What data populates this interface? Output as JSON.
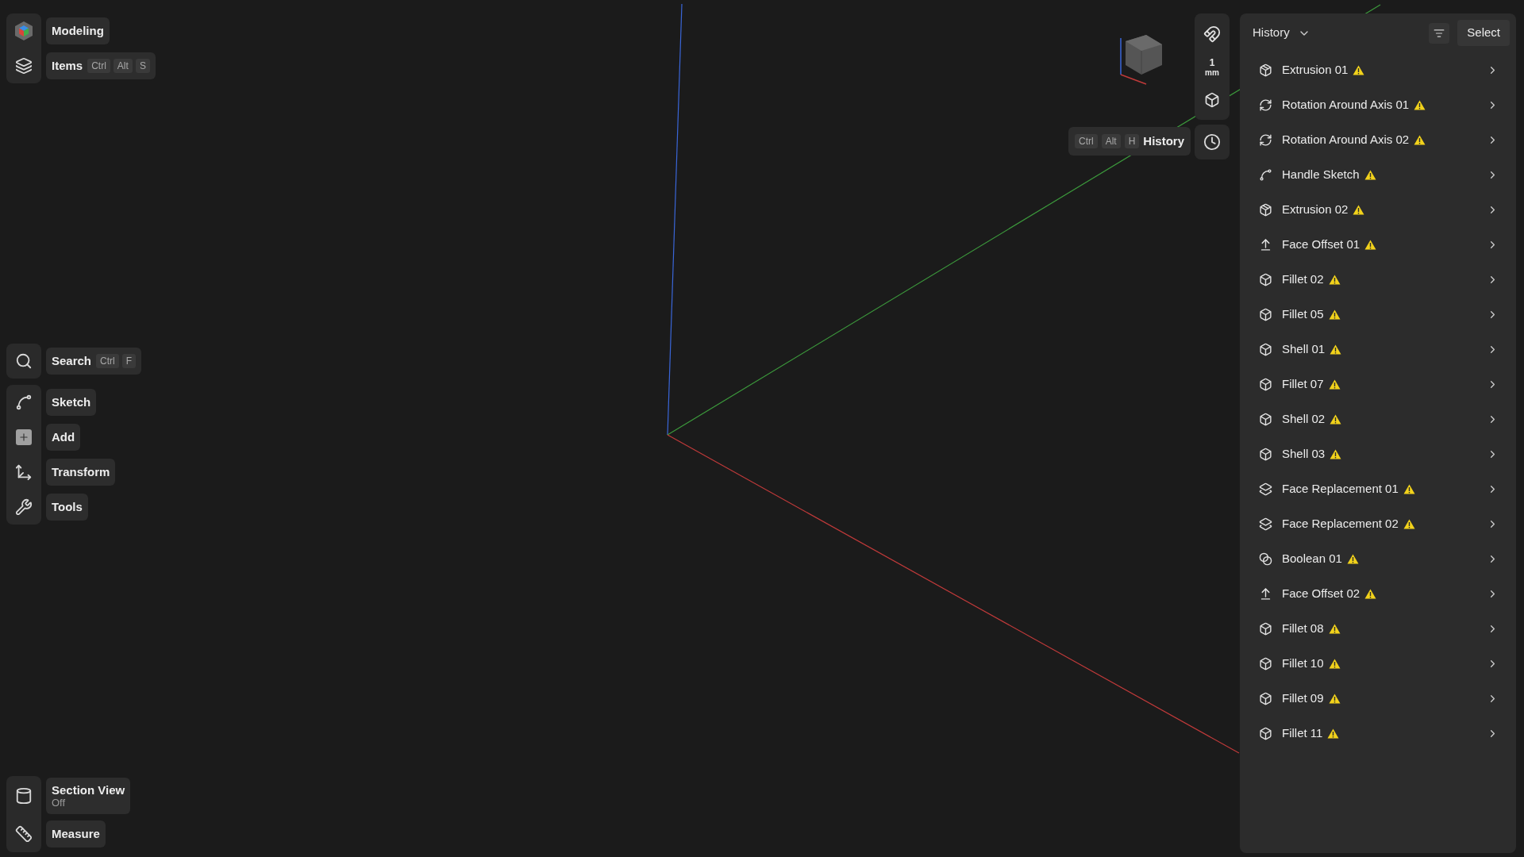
{
  "workspace_button": {
    "label": "Modeling"
  },
  "items_button": {
    "label": "Items",
    "shortcut": [
      "Ctrl",
      "Alt",
      "S"
    ]
  },
  "search_button": {
    "label": "Search",
    "shortcut": [
      "Ctrl",
      "F"
    ]
  },
  "tools": [
    {
      "kind": "sketch",
      "label": "Sketch"
    },
    {
      "kind": "add",
      "label": "Add"
    },
    {
      "kind": "transform",
      "label": "Transform"
    },
    {
      "kind": "tools",
      "label": "Tools"
    }
  ],
  "section_view": {
    "label": "Section View",
    "status": "Off"
  },
  "measure_button": {
    "label": "Measure"
  },
  "view_toolbar": {
    "grid_value": "1",
    "grid_unit": "mm"
  },
  "history_tooltip": {
    "shortcut": [
      "Ctrl",
      "Alt",
      "H"
    ],
    "label": "History"
  },
  "history_panel": {
    "title": "History",
    "select_button": "Select",
    "items": [
      {
        "kind": "extrusion",
        "label": "Extrusion 01",
        "warning": true
      },
      {
        "kind": "rotation",
        "label": "Rotation Around Axis 01",
        "warning": true
      },
      {
        "kind": "rotation",
        "label": "Rotation Around Axis 02",
        "warning": true
      },
      {
        "kind": "sketch",
        "label": "Handle Sketch",
        "warning": true
      },
      {
        "kind": "extrusion",
        "label": "Extrusion 02",
        "warning": true
      },
      {
        "kind": "face_offset",
        "label": "Face Offset 01",
        "warning": true
      },
      {
        "kind": "fillet",
        "label": "Fillet 02",
        "warning": true
      },
      {
        "kind": "fillet",
        "label": "Fillet 05",
        "warning": true
      },
      {
        "kind": "shell",
        "label": "Shell 01",
        "warning": true
      },
      {
        "kind": "fillet",
        "label": "Fillet 07",
        "warning": true
      },
      {
        "kind": "shell",
        "label": "Shell 02",
        "warning": true
      },
      {
        "kind": "shell",
        "label": "Shell 03",
        "warning": true
      },
      {
        "kind": "face_replacement",
        "label": "Face Replacement 01",
        "warning": true
      },
      {
        "kind": "face_replacement",
        "label": "Face Replacement 02",
        "warning": true
      },
      {
        "kind": "boolean",
        "label": "Boolean 01",
        "warning": true
      },
      {
        "kind": "face_offset",
        "label": "Face Offset 02",
        "warning": true
      },
      {
        "kind": "fillet",
        "label": "Fillet 08",
        "warning": true
      },
      {
        "kind": "fillet",
        "label": "Fillet 10",
        "warning": true
      },
      {
        "kind": "fillet",
        "label": "Fillet 09",
        "warning": true
      },
      {
        "kind": "fillet",
        "label": "Fillet 11",
        "warning": true
      }
    ]
  }
}
